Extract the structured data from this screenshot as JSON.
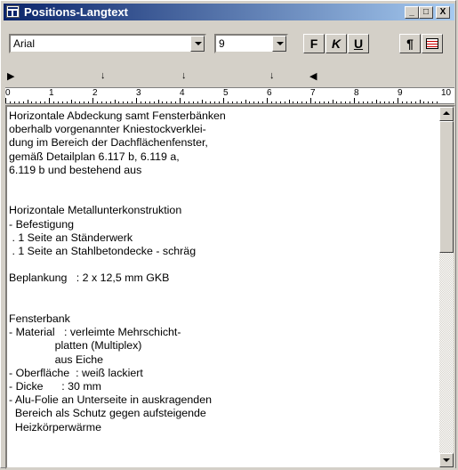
{
  "window": {
    "title": "Positions-Langtext",
    "min_label": "_",
    "max_label": "□",
    "close_label": "X"
  },
  "toolbar": {
    "font": "Arial",
    "size": "9",
    "bold_label": "F",
    "italic_label": "K",
    "underline_label": "U",
    "pilcrow_label": "¶"
  },
  "ruler": {
    "tab_markers": [
      "▶",
      "↓",
      "↓",
      "↓",
      "◀"
    ],
    "numbers": [
      "0",
      "1",
      "2",
      "3",
      "4",
      "5",
      "6",
      "7",
      "8",
      "9",
      "10"
    ]
  },
  "editor": {
    "lines": [
      "Horizontale Abdeckung samt Fensterbänken",
      "oberhalb vorgenannter Kniestockverklei-",
      "dung im Bereich der Dachflächenfenster,",
      "gemäß Detailplan 6.117 b, 6.119 a,",
      "6.119 b und bestehend aus",
      "",
      "",
      "Horizontale Metallunterkonstruktion",
      "- Befestigung",
      " . 1 Seite an Ständerwerk",
      " . 1 Seite an Stahlbetondecke - schräg",
      "",
      "Beplankung   : 2 x 12,5 mm GKB",
      "",
      "",
      "Fensterbank",
      "- Material   : verleimte Mehrschicht-",
      "               platten (Multiplex)",
      "               aus Eiche",
      "- Oberfläche  : weiß lackiert",
      "- Dicke      : 30 mm",
      "- Alu-Folie an Unterseite in auskragenden",
      "  Bereich als Schutz gegen aufsteigende",
      "  Heizkörperwärme"
    ]
  }
}
